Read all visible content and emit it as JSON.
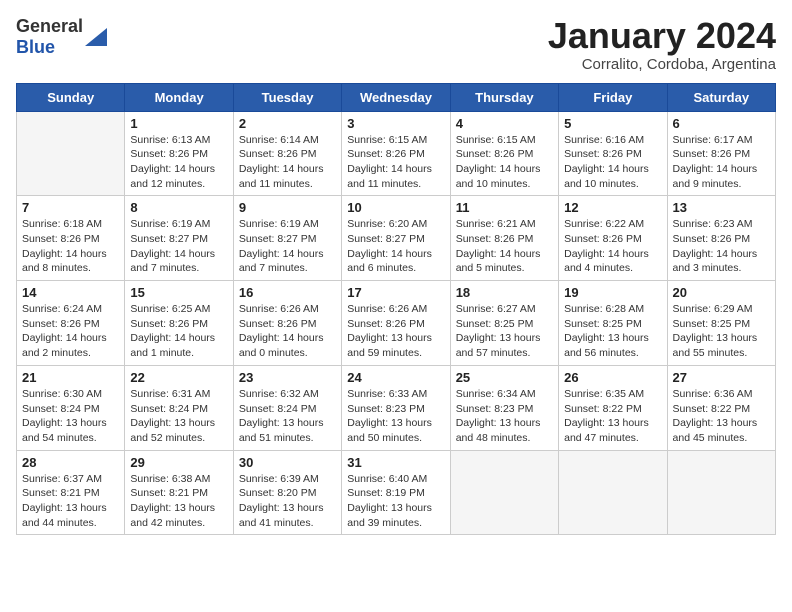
{
  "logo": {
    "general": "General",
    "blue": "Blue"
  },
  "header": {
    "title": "January 2024",
    "subtitle": "Corralito, Cordoba, Argentina"
  },
  "weekdays": [
    "Sunday",
    "Monday",
    "Tuesday",
    "Wednesday",
    "Thursday",
    "Friday",
    "Saturday"
  ],
  "weeks": [
    [
      {
        "day": "",
        "info": ""
      },
      {
        "day": "1",
        "info": "Sunrise: 6:13 AM\nSunset: 8:26 PM\nDaylight: 14 hours\nand 12 minutes."
      },
      {
        "day": "2",
        "info": "Sunrise: 6:14 AM\nSunset: 8:26 PM\nDaylight: 14 hours\nand 11 minutes."
      },
      {
        "day": "3",
        "info": "Sunrise: 6:15 AM\nSunset: 8:26 PM\nDaylight: 14 hours\nand 11 minutes."
      },
      {
        "day": "4",
        "info": "Sunrise: 6:15 AM\nSunset: 8:26 PM\nDaylight: 14 hours\nand 10 minutes."
      },
      {
        "day": "5",
        "info": "Sunrise: 6:16 AM\nSunset: 8:26 PM\nDaylight: 14 hours\nand 10 minutes."
      },
      {
        "day": "6",
        "info": "Sunrise: 6:17 AM\nSunset: 8:26 PM\nDaylight: 14 hours\nand 9 minutes."
      }
    ],
    [
      {
        "day": "7",
        "info": "Sunrise: 6:18 AM\nSunset: 8:26 PM\nDaylight: 14 hours\nand 8 minutes."
      },
      {
        "day": "8",
        "info": "Sunrise: 6:19 AM\nSunset: 8:27 PM\nDaylight: 14 hours\nand 7 minutes."
      },
      {
        "day": "9",
        "info": "Sunrise: 6:19 AM\nSunset: 8:27 PM\nDaylight: 14 hours\nand 7 minutes."
      },
      {
        "day": "10",
        "info": "Sunrise: 6:20 AM\nSunset: 8:27 PM\nDaylight: 14 hours\nand 6 minutes."
      },
      {
        "day": "11",
        "info": "Sunrise: 6:21 AM\nSunset: 8:26 PM\nDaylight: 14 hours\nand 5 minutes."
      },
      {
        "day": "12",
        "info": "Sunrise: 6:22 AM\nSunset: 8:26 PM\nDaylight: 14 hours\nand 4 minutes."
      },
      {
        "day": "13",
        "info": "Sunrise: 6:23 AM\nSunset: 8:26 PM\nDaylight: 14 hours\nand 3 minutes."
      }
    ],
    [
      {
        "day": "14",
        "info": "Sunrise: 6:24 AM\nSunset: 8:26 PM\nDaylight: 14 hours\nand 2 minutes."
      },
      {
        "day": "15",
        "info": "Sunrise: 6:25 AM\nSunset: 8:26 PM\nDaylight: 14 hours\nand 1 minute."
      },
      {
        "day": "16",
        "info": "Sunrise: 6:26 AM\nSunset: 8:26 PM\nDaylight: 14 hours\nand 0 minutes."
      },
      {
        "day": "17",
        "info": "Sunrise: 6:26 AM\nSunset: 8:26 PM\nDaylight: 13 hours\nand 59 minutes."
      },
      {
        "day": "18",
        "info": "Sunrise: 6:27 AM\nSunset: 8:25 PM\nDaylight: 13 hours\nand 57 minutes."
      },
      {
        "day": "19",
        "info": "Sunrise: 6:28 AM\nSunset: 8:25 PM\nDaylight: 13 hours\nand 56 minutes."
      },
      {
        "day": "20",
        "info": "Sunrise: 6:29 AM\nSunset: 8:25 PM\nDaylight: 13 hours\nand 55 minutes."
      }
    ],
    [
      {
        "day": "21",
        "info": "Sunrise: 6:30 AM\nSunset: 8:24 PM\nDaylight: 13 hours\nand 54 minutes."
      },
      {
        "day": "22",
        "info": "Sunrise: 6:31 AM\nSunset: 8:24 PM\nDaylight: 13 hours\nand 52 minutes."
      },
      {
        "day": "23",
        "info": "Sunrise: 6:32 AM\nSunset: 8:24 PM\nDaylight: 13 hours\nand 51 minutes."
      },
      {
        "day": "24",
        "info": "Sunrise: 6:33 AM\nSunset: 8:23 PM\nDaylight: 13 hours\nand 50 minutes."
      },
      {
        "day": "25",
        "info": "Sunrise: 6:34 AM\nSunset: 8:23 PM\nDaylight: 13 hours\nand 48 minutes."
      },
      {
        "day": "26",
        "info": "Sunrise: 6:35 AM\nSunset: 8:22 PM\nDaylight: 13 hours\nand 47 minutes."
      },
      {
        "day": "27",
        "info": "Sunrise: 6:36 AM\nSunset: 8:22 PM\nDaylight: 13 hours\nand 45 minutes."
      }
    ],
    [
      {
        "day": "28",
        "info": "Sunrise: 6:37 AM\nSunset: 8:21 PM\nDaylight: 13 hours\nand 44 minutes."
      },
      {
        "day": "29",
        "info": "Sunrise: 6:38 AM\nSunset: 8:21 PM\nDaylight: 13 hours\nand 42 minutes."
      },
      {
        "day": "30",
        "info": "Sunrise: 6:39 AM\nSunset: 8:20 PM\nDaylight: 13 hours\nand 41 minutes."
      },
      {
        "day": "31",
        "info": "Sunrise: 6:40 AM\nSunset: 8:19 PM\nDaylight: 13 hours\nand 39 minutes."
      },
      {
        "day": "",
        "info": ""
      },
      {
        "day": "",
        "info": ""
      },
      {
        "day": "",
        "info": ""
      }
    ]
  ]
}
